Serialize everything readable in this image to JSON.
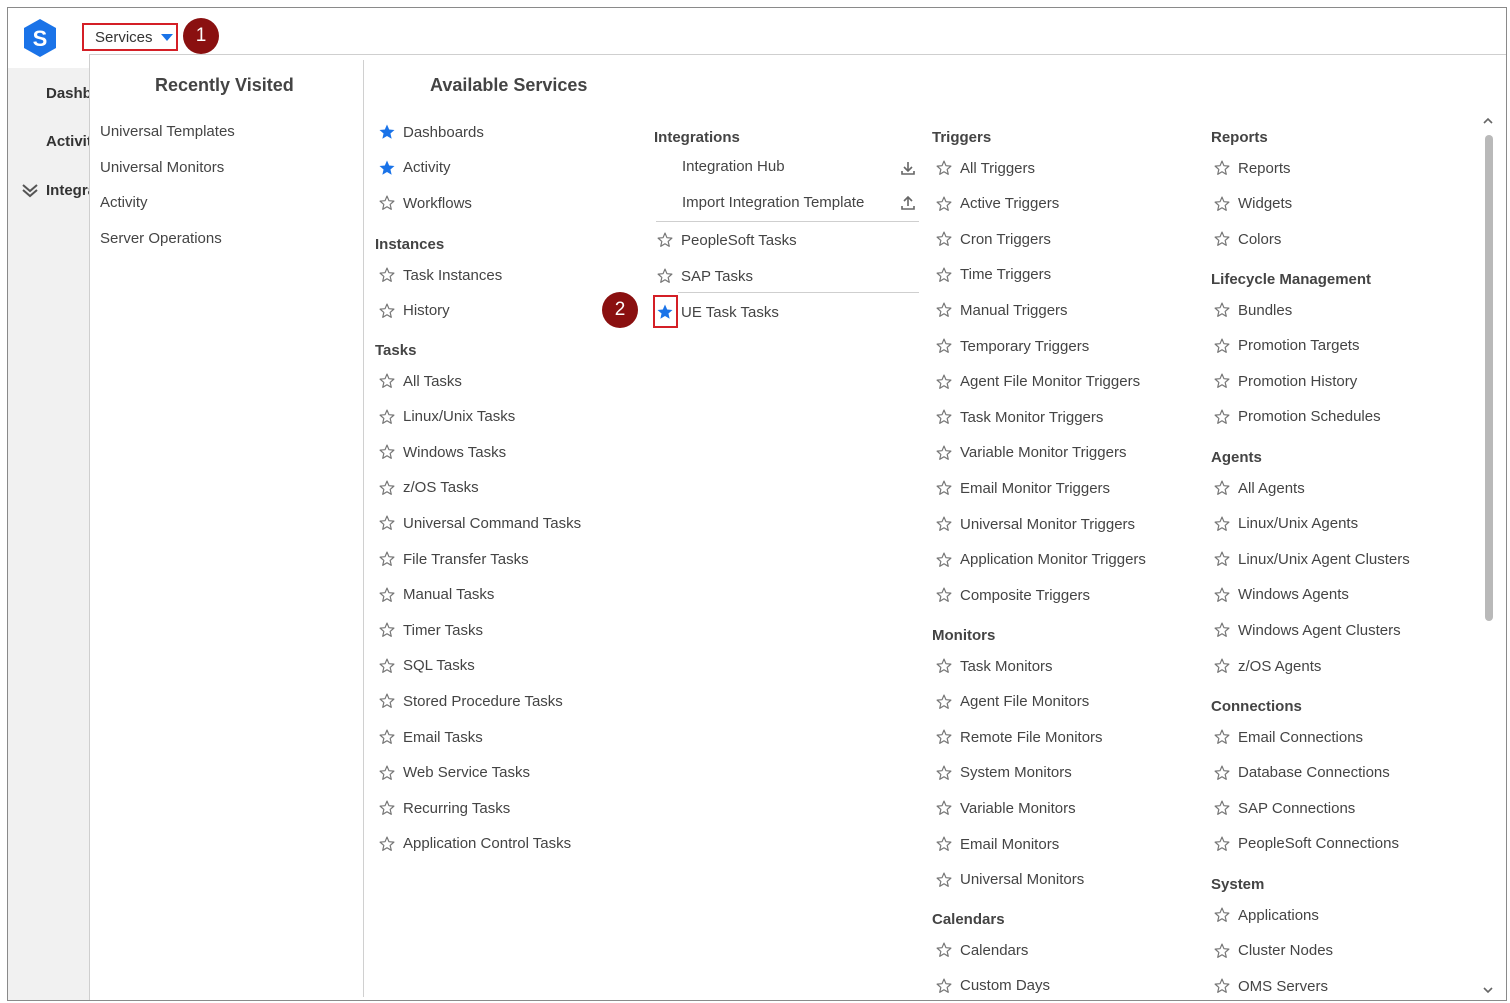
{
  "topbar": {
    "logo_letter": "S",
    "services_label": "Services"
  },
  "callouts": [
    "1",
    "2"
  ],
  "leftnav": {
    "items": [
      "Dashboards",
      "Activity",
      "Integrations"
    ]
  },
  "recently_visited": {
    "title": "Recently Visited",
    "items": [
      "Universal Templates",
      "Universal Monitors",
      "Activity",
      "Server Operations"
    ]
  },
  "available_services": {
    "title": "Available Services",
    "col1": {
      "top": [
        {
          "label": "Dashboards",
          "favorite": true
        },
        {
          "label": "Activity",
          "favorite": true
        },
        {
          "label": "Workflows",
          "favorite": false
        }
      ],
      "instances_head": "Instances",
      "instances": [
        {
          "label": "Task Instances",
          "favorite": false
        },
        {
          "label": "History",
          "favorite": false
        }
      ],
      "tasks_head": "Tasks",
      "tasks": [
        {
          "label": "All Tasks"
        },
        {
          "label": "Linux/Unix Tasks"
        },
        {
          "label": "Windows Tasks"
        },
        {
          "label": "z/OS Tasks"
        },
        {
          "label": "Universal Command Tasks"
        },
        {
          "label": "File Transfer Tasks"
        },
        {
          "label": "Manual Tasks"
        },
        {
          "label": "Timer Tasks"
        },
        {
          "label": "SQL Tasks"
        },
        {
          "label": "Stored Procedure Tasks"
        },
        {
          "label": "Email Tasks"
        },
        {
          "label": "Web Service Tasks"
        },
        {
          "label": "Recurring Tasks"
        },
        {
          "label": "Application Control Tasks"
        }
      ]
    },
    "col2": {
      "integrations_head": "Integrations",
      "integration_hub": "Integration Hub",
      "import_template": "Import Integration Template",
      "items": [
        {
          "label": "PeopleSoft Tasks",
          "favorite": false
        },
        {
          "label": "SAP Tasks",
          "favorite": false
        },
        {
          "label": "UE Task Tasks",
          "favorite": true
        }
      ]
    },
    "col3": {
      "triggers_head": "Triggers",
      "triggers": [
        {
          "label": "All Triggers"
        },
        {
          "label": "Active Triggers"
        },
        {
          "label": "Cron Triggers"
        },
        {
          "label": "Time Triggers"
        },
        {
          "label": "Manual Triggers"
        },
        {
          "label": "Temporary Triggers"
        },
        {
          "label": "Agent File Monitor Triggers"
        },
        {
          "label": "Task Monitor Triggers"
        },
        {
          "label": "Variable Monitor Triggers"
        },
        {
          "label": "Email Monitor Triggers"
        },
        {
          "label": "Universal Monitor Triggers"
        },
        {
          "label": "Application Monitor Triggers"
        },
        {
          "label": "Composite Triggers"
        }
      ],
      "monitors_head": "Monitors",
      "monitors": [
        {
          "label": "Task Monitors"
        },
        {
          "label": "Agent File Monitors"
        },
        {
          "label": "Remote File Monitors"
        },
        {
          "label": "System Monitors"
        },
        {
          "label": "Variable Monitors"
        },
        {
          "label": "Email Monitors"
        },
        {
          "label": "Universal Monitors"
        }
      ],
      "calendars_head": "Calendars",
      "calendars": [
        {
          "label": "Calendars"
        },
        {
          "label": "Custom Days"
        }
      ]
    },
    "col4": {
      "reports_head": "Reports",
      "reports": [
        {
          "label": "Reports"
        },
        {
          "label": "Widgets"
        },
        {
          "label": "Colors"
        }
      ],
      "lifecycle_head": "Lifecycle Management",
      "lifecycle": [
        {
          "label": "Bundles"
        },
        {
          "label": "Promotion Targets"
        },
        {
          "label": "Promotion History"
        },
        {
          "label": "Promotion Schedules"
        }
      ],
      "agents_head": "Agents",
      "agents": [
        {
          "label": "All Agents"
        },
        {
          "label": "Linux/Unix Agents"
        },
        {
          "label": "Linux/Unix Agent Clusters"
        },
        {
          "label": "Windows Agents"
        },
        {
          "label": "Windows Agent Clusters"
        },
        {
          "label": "z/OS Agents"
        }
      ],
      "connections_head": "Connections",
      "connections": [
        {
          "label": "Email Connections"
        },
        {
          "label": "Database Connections"
        },
        {
          "label": "SAP Connections"
        },
        {
          "label": "PeopleSoft Connections"
        }
      ],
      "system_head": "System",
      "system": [
        {
          "label": "Applications"
        },
        {
          "label": "Cluster Nodes"
        },
        {
          "label": "OMS Servers"
        }
      ]
    }
  },
  "colors": {
    "favorite_star": "#1a73e8",
    "empty_star": "#777777",
    "callout_bg": "#8a1010",
    "highlight_border": "#d41f26",
    "logo_bg": "#1a73e8"
  },
  "icons": {
    "favorite": "star-filled-icon",
    "not_favorite": "star-outline-icon",
    "download": "download-icon",
    "upload": "upload-icon"
  }
}
